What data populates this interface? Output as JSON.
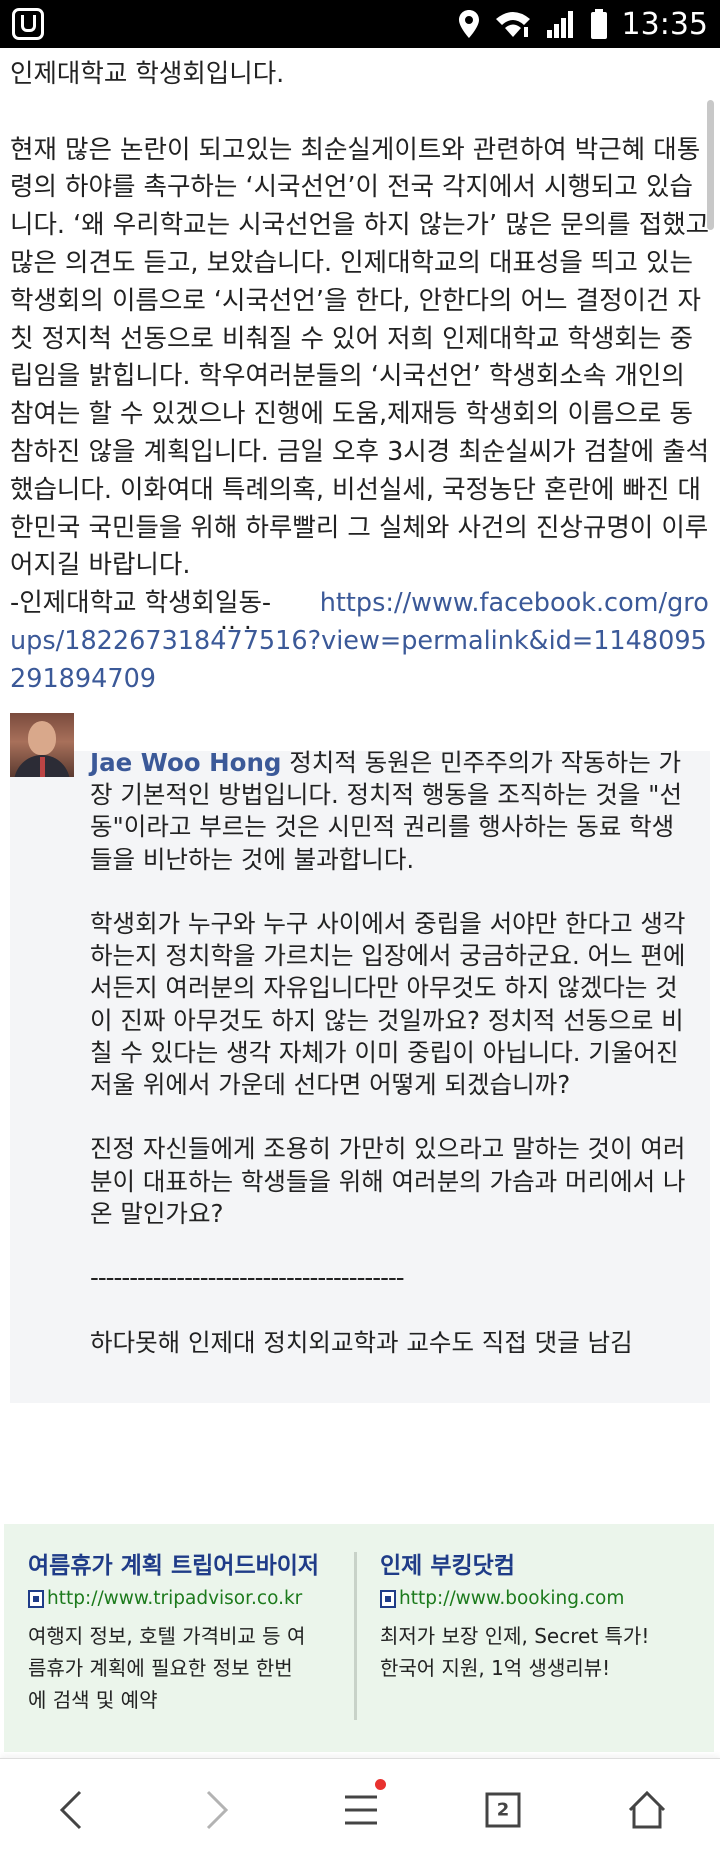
{
  "status_bar": {
    "time": "13:35"
  },
  "article": {
    "greeting": "인제대학교 학생회입니다.",
    "body": "현재 많은 논란이 되고있는 최순실게이트와 관련하여 박근혜 대통령의 하야를 촉구하는 ‘시국선언’이 전국 각지에서 시행되고 있습니다. ‘왜 우리학교는 시국선언을 하지 않는가’ 많은 문의를 접했고 많은 의견도 듣고, 보았습니다. 인제대학교의 대표성을 띄고 있는 학생회의 이름으로 ‘시국선언’을 한다, 안한다의 어느 결정이건 자칫 정지척 선동으로 비춰질 수 있어 저희 인제대학교 학생회는 중립임을 밝힙니다. 학우여러분들의 ‘시국선언’ 학생회소속 개인의 참여는 할 수 있겠으나 진행에 도움,제재등 학생회의 이름으로 동참하진 않을 계획입니다. 금일 오후 3시경 최순실씨가 검찰에 출석했습니다. 이화여대 특례의혹, 비선실세, 국정농단 혼란에 빠진 대한민국 국민들을 위해 하루빨리 그 실체와 사건의 진상규명이 이루어지길 바랍니다.",
    "signature": "-인제대학교 학생회일동-",
    "url": "https://www.facebook.com/groups/182267318477516?view=permalink&id=1148095291894709",
    "url_trail": "..    ."
  },
  "comment": {
    "author": "Jae Woo Hong",
    "p1": "정치적 동원은 민주주의가 작동하는 가장 기본적인 방법입니다. 정치적 행동을 조직하는 것을 \"선동\"이라고 부르는 것은 시민적 권리를 행사하는 동료 학생들을 비난하는 것에 불과합니다.",
    "p2": "학생회가 누구와 누구 사이에서 중립을 서야만 한다고 생각하는지 정치학을 가르치는 입장에서 궁금하군요. 어느 편에 서든지 여러분의 자유입니다만 아무것도 하지 않겠다는 것이 진짜 아무것도 하지 않는 것일까요? 정치적 선동으로 비칠 수 있다는 생각 자체가 이미 중립이 아닙니다. 기울어진 저울 위에서 가운데 선다면 어떻게 되겠습니까?",
    "p3": "진정 자신들에게 조용히 가만히 있으라고 말하는 것이 여러분이 대표하는 학생들을 위해 여러분의 가슴과 머리에서 나온 말인가요?",
    "divider": "----------------------------------------",
    "note": "하다못해 인제대 정치외교학과 교수도 직접 댓글 남김"
  },
  "ads": [
    {
      "title": "여름휴가 계획 트립어드바이저",
      "link": "http://www.tripadvisor.co.kr",
      "desc_lines": [
        "여행지 정보, 호텔 가격비교 등 여",
        "름휴가 계획에 필요한 정보 한번",
        "에 검색 및 예약"
      ]
    },
    {
      "title": "인제 부킹닷컴",
      "link": "http://www.booking.com",
      "desc_lines": [
        "최저가 보장 인제, Secret 특가!",
        "한국어 지원, 1억 생생리뷰!"
      ]
    }
  ],
  "nav": {
    "tab_count": "2"
  },
  "colors": {
    "link": "#3b5998",
    "ad_title": "#1f3c88",
    "ad_link": "#1c7a1c",
    "ad_bg": "#ebf5eb",
    "comment_bg": "#f4f5f7",
    "badge": "#e8312f"
  }
}
